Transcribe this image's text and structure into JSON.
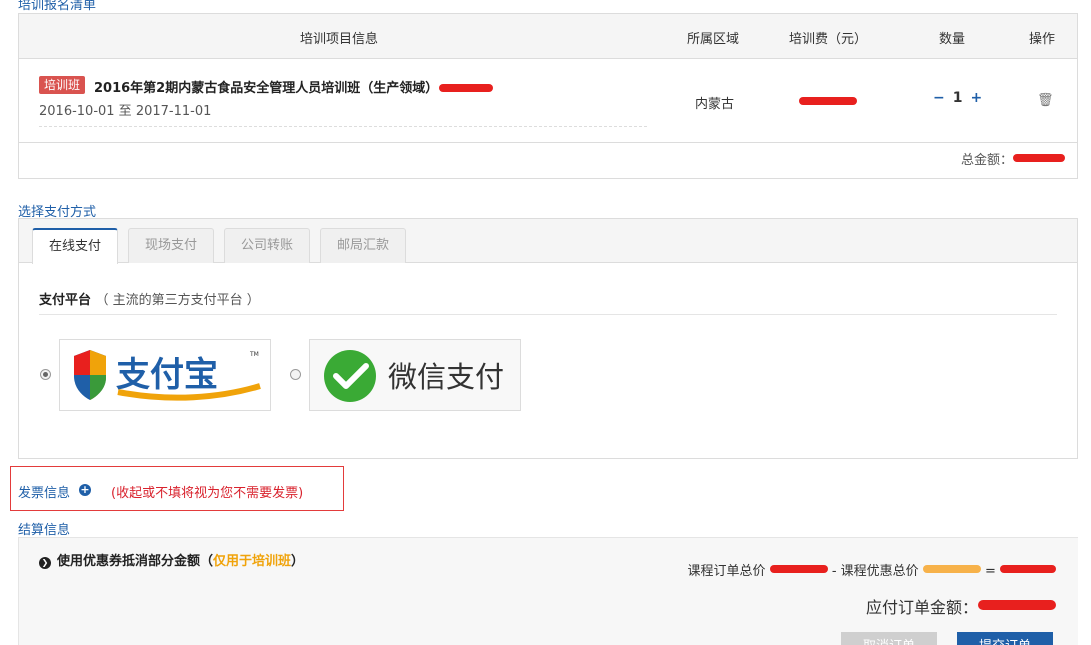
{
  "sections": {
    "registration": "培训报名清单",
    "payment": "选择支付方式",
    "settlement": "结算信息"
  },
  "order": {
    "headers": [
      "培训项目信息",
      "所属区域",
      "培训费（元）",
      "数量",
      "操作"
    ],
    "item": {
      "badge": "培训班",
      "name": "2016年第2期内蒙古食品安全管理人员培训班（生产领域）",
      "dates": "2016-10-01 至 2017-11-01",
      "region": "内蒙古",
      "quantity": "1",
      "minus": "−",
      "plus": "+",
      "trash_glyph": "🗑"
    },
    "total_label": "总金额："
  },
  "payment": {
    "tabs": [
      "在线支付",
      "现场支付",
      "公司转账",
      "邮局汇款"
    ],
    "platform_title": "支付平台",
    "platform_note": "（ 主流的第三方支付平台 ）",
    "options": [
      {
        "label": "支付宝",
        "tm": "TM",
        "selected": true
      },
      {
        "label": "微信支付",
        "selected": false
      }
    ]
  },
  "invoice": {
    "label": "发票信息",
    "plus_glyph": "+",
    "note": "(收起或不填将视为您不需要发票)"
  },
  "settlement": {
    "chevron": "❯",
    "coupon_prefix": "使用优惠券抵消部分金额（",
    "coupon_highlight": "仅用于培训班",
    "coupon_suffix": "）",
    "course_total_label": "课程订单总价",
    "discount_label": "- 课程优惠总价",
    "equals": "=",
    "due_label": "应付订单金额：",
    "cancel": "取消订单",
    "submit": "提交订单"
  },
  "colors": {
    "primary": "#1f5fa8",
    "badge": "#d9534f",
    "redaction": "#e8201e",
    "orange": "#f0a30a",
    "alert": "#e33b3b"
  }
}
